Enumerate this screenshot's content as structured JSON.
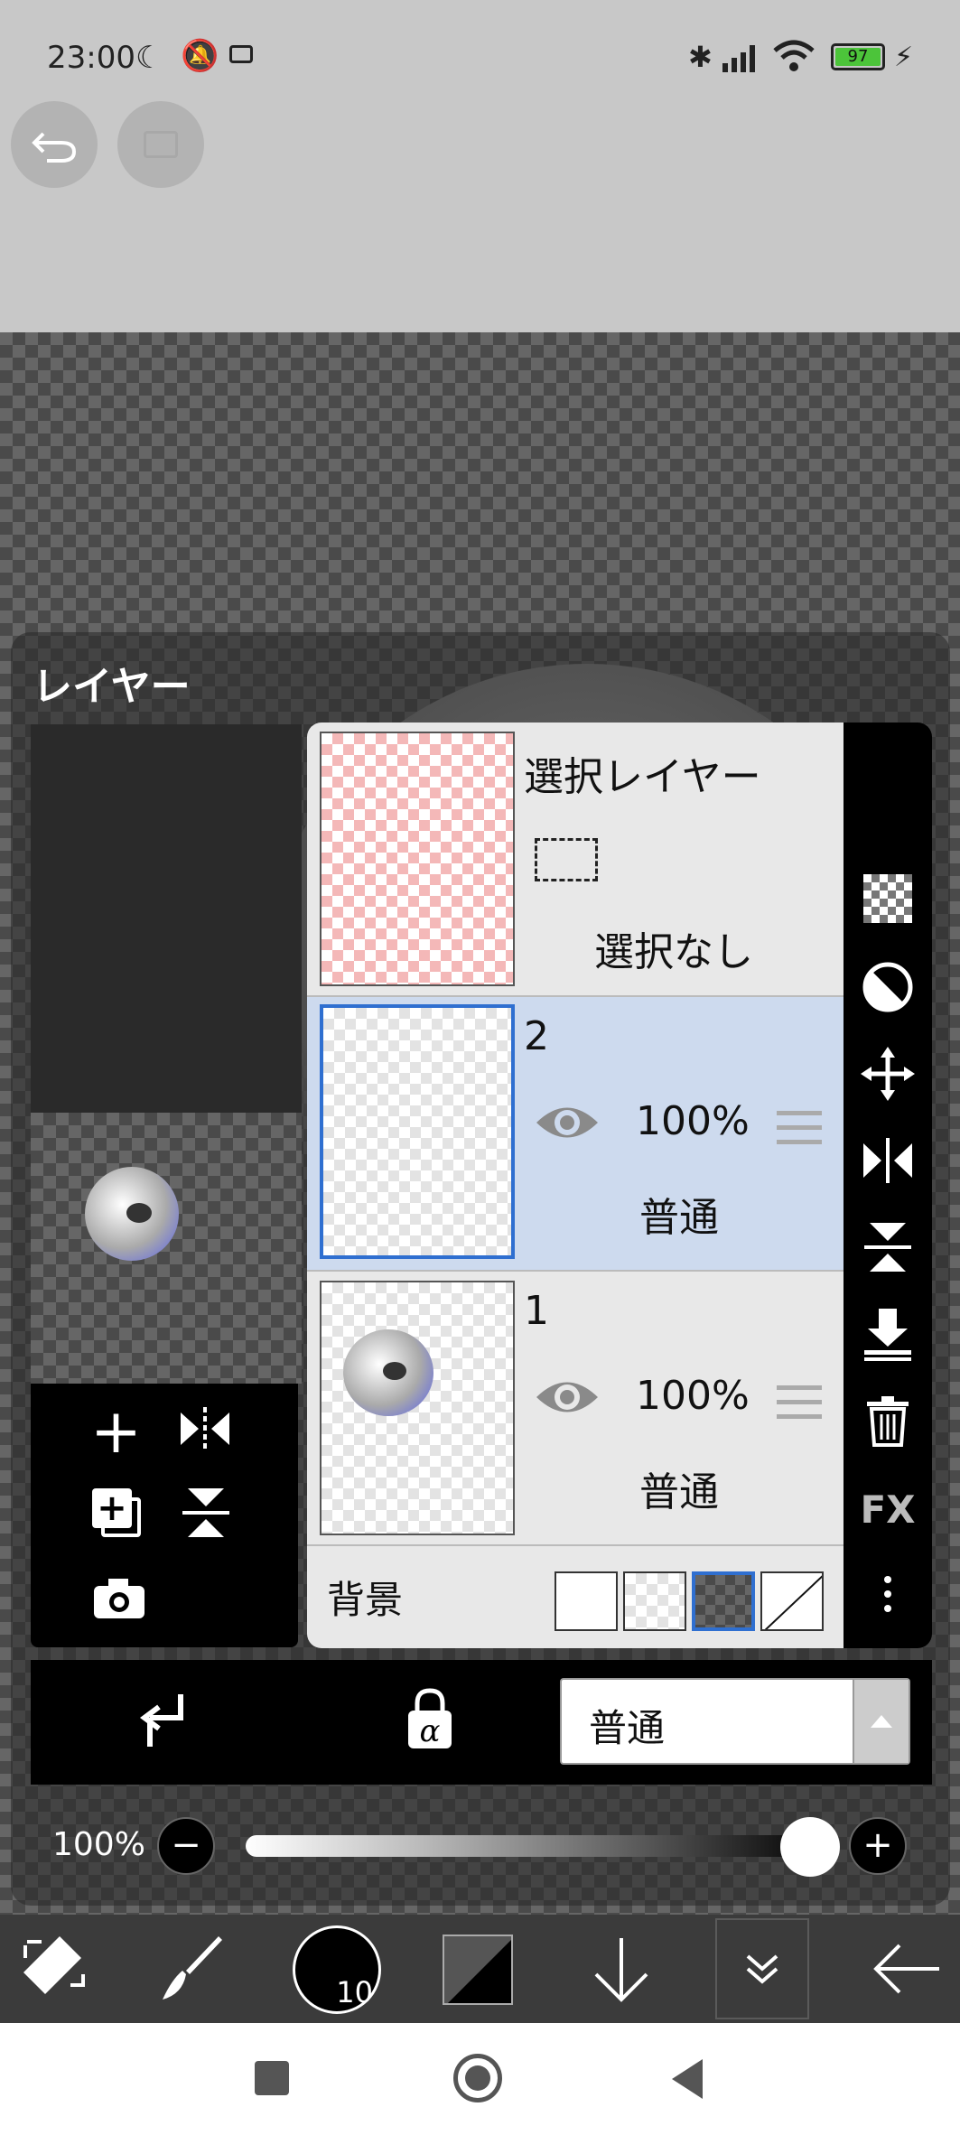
{
  "status_bar": {
    "time": "23:00",
    "battery": "97"
  },
  "layer_panel": {
    "title": "レイヤー",
    "selection_layer": {
      "name": "選択レイヤー",
      "state": "選択なし"
    },
    "layers": [
      {
        "name": "2",
        "opacity": "100%",
        "blend": "普通",
        "selected": true
      },
      {
        "name": "1",
        "opacity": "100%",
        "blend": "普通",
        "selected": false
      }
    ],
    "background_label": "背景",
    "sidebar_fx": "FX"
  },
  "bottom_controls": {
    "blend_mode": "普通",
    "opacity_value": "100%"
  },
  "toolbar": {
    "brush_size": "10"
  },
  "colors": {
    "selected_row": "#cddaee",
    "selected_border": "#2f6fd0"
  }
}
